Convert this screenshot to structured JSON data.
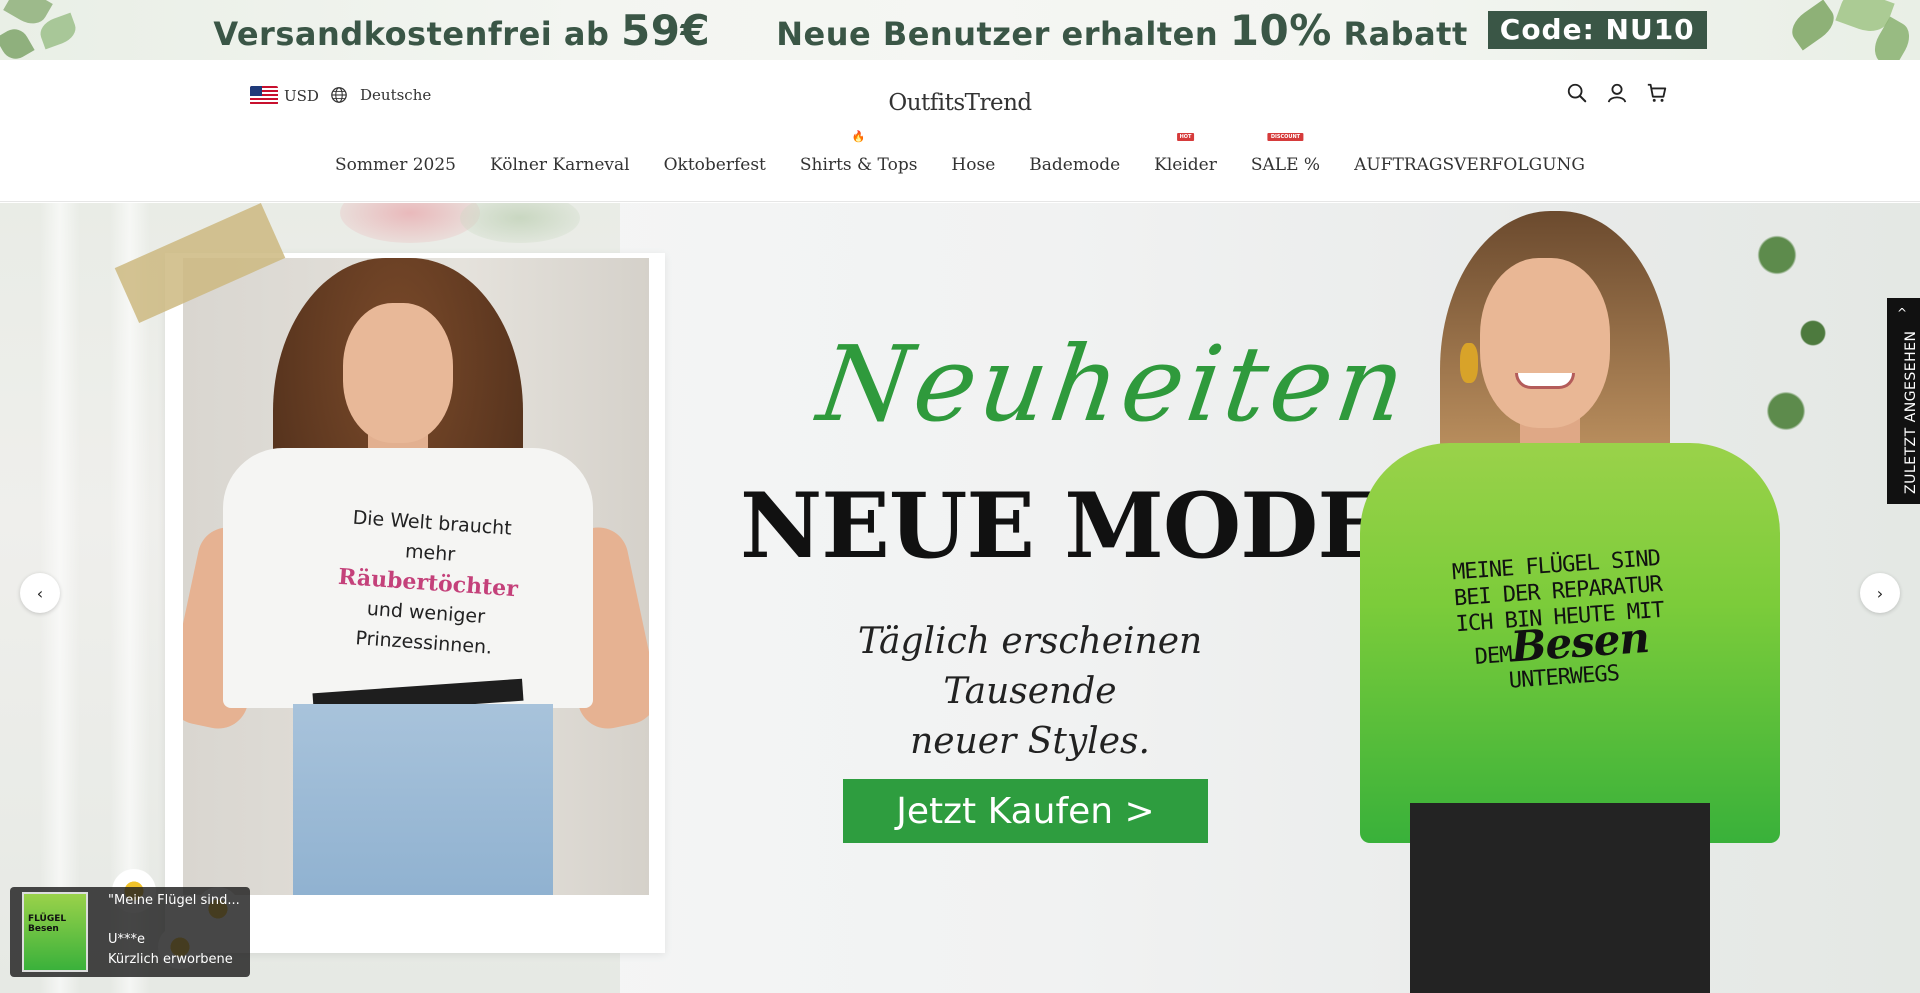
{
  "promo": {
    "free_shipping_text": "Versandkostenfrei ab",
    "free_shipping_amount": "59€",
    "new_user_text": "Neue Benutzer erhalten",
    "discount_amount": "10%",
    "discount_word": "Rabatt",
    "code_label": "Code: NU10"
  },
  "header": {
    "currency": "USD",
    "language": "Deutsche",
    "logo": "OutfitsTrend",
    "icons": [
      "search-icon",
      "account-icon",
      "cart-icon"
    ]
  },
  "nav": {
    "items": [
      {
        "label": "Sommer 2025",
        "badge": ""
      },
      {
        "label": "Kölner Karneval",
        "badge": ""
      },
      {
        "label": "Oktoberfest",
        "badge": ""
      },
      {
        "label": "Shirts & Tops",
        "badge": "🔥"
      },
      {
        "label": "Hose",
        "badge": ""
      },
      {
        "label": "Bademode",
        "badge": ""
      },
      {
        "label": "Kleider",
        "badge": "HOT"
      },
      {
        "label": "SALE %",
        "badge": "DISCOUNT"
      },
      {
        "label": "AUFTRAGSVERFOLGUNG",
        "badge": ""
      }
    ]
  },
  "hero": {
    "script_title": "Neuheiten",
    "title": "NEUE MODE",
    "subtitle_line1": "Täglich erscheinen Tausende",
    "subtitle_line2": "neuer Styles.",
    "cta": "Jetzt Kaufen >",
    "left_shirt": {
      "line1": "Die Welt braucht",
      "line2": "mehr",
      "line3": "Räubertöchter",
      "line4": "und weniger",
      "line5": "Prinzessinnen."
    },
    "right_shirt": {
      "line1": "MEINE FLÜGEL SIND",
      "line2": "BEI DER REPARATUR",
      "line3": "ICH BIN HEUTE MIT",
      "line4_prefix": "DEM",
      "line4_word": "Besen",
      "line5": "UNTERWEGS"
    },
    "prev_arrow": "‹",
    "next_arrow": "›"
  },
  "recently_viewed": {
    "label": "ZULETZT ANGESEHEN",
    "chevron": "^"
  },
  "toast": {
    "product": "\"Meine Flügel sind...",
    "user": "U***e",
    "status": "Kürzlich erworbene"
  },
  "colors": {
    "promo_text": "#3a5646",
    "accent_green": "#2e9d3f",
    "badge_red": "#d63b3b"
  }
}
